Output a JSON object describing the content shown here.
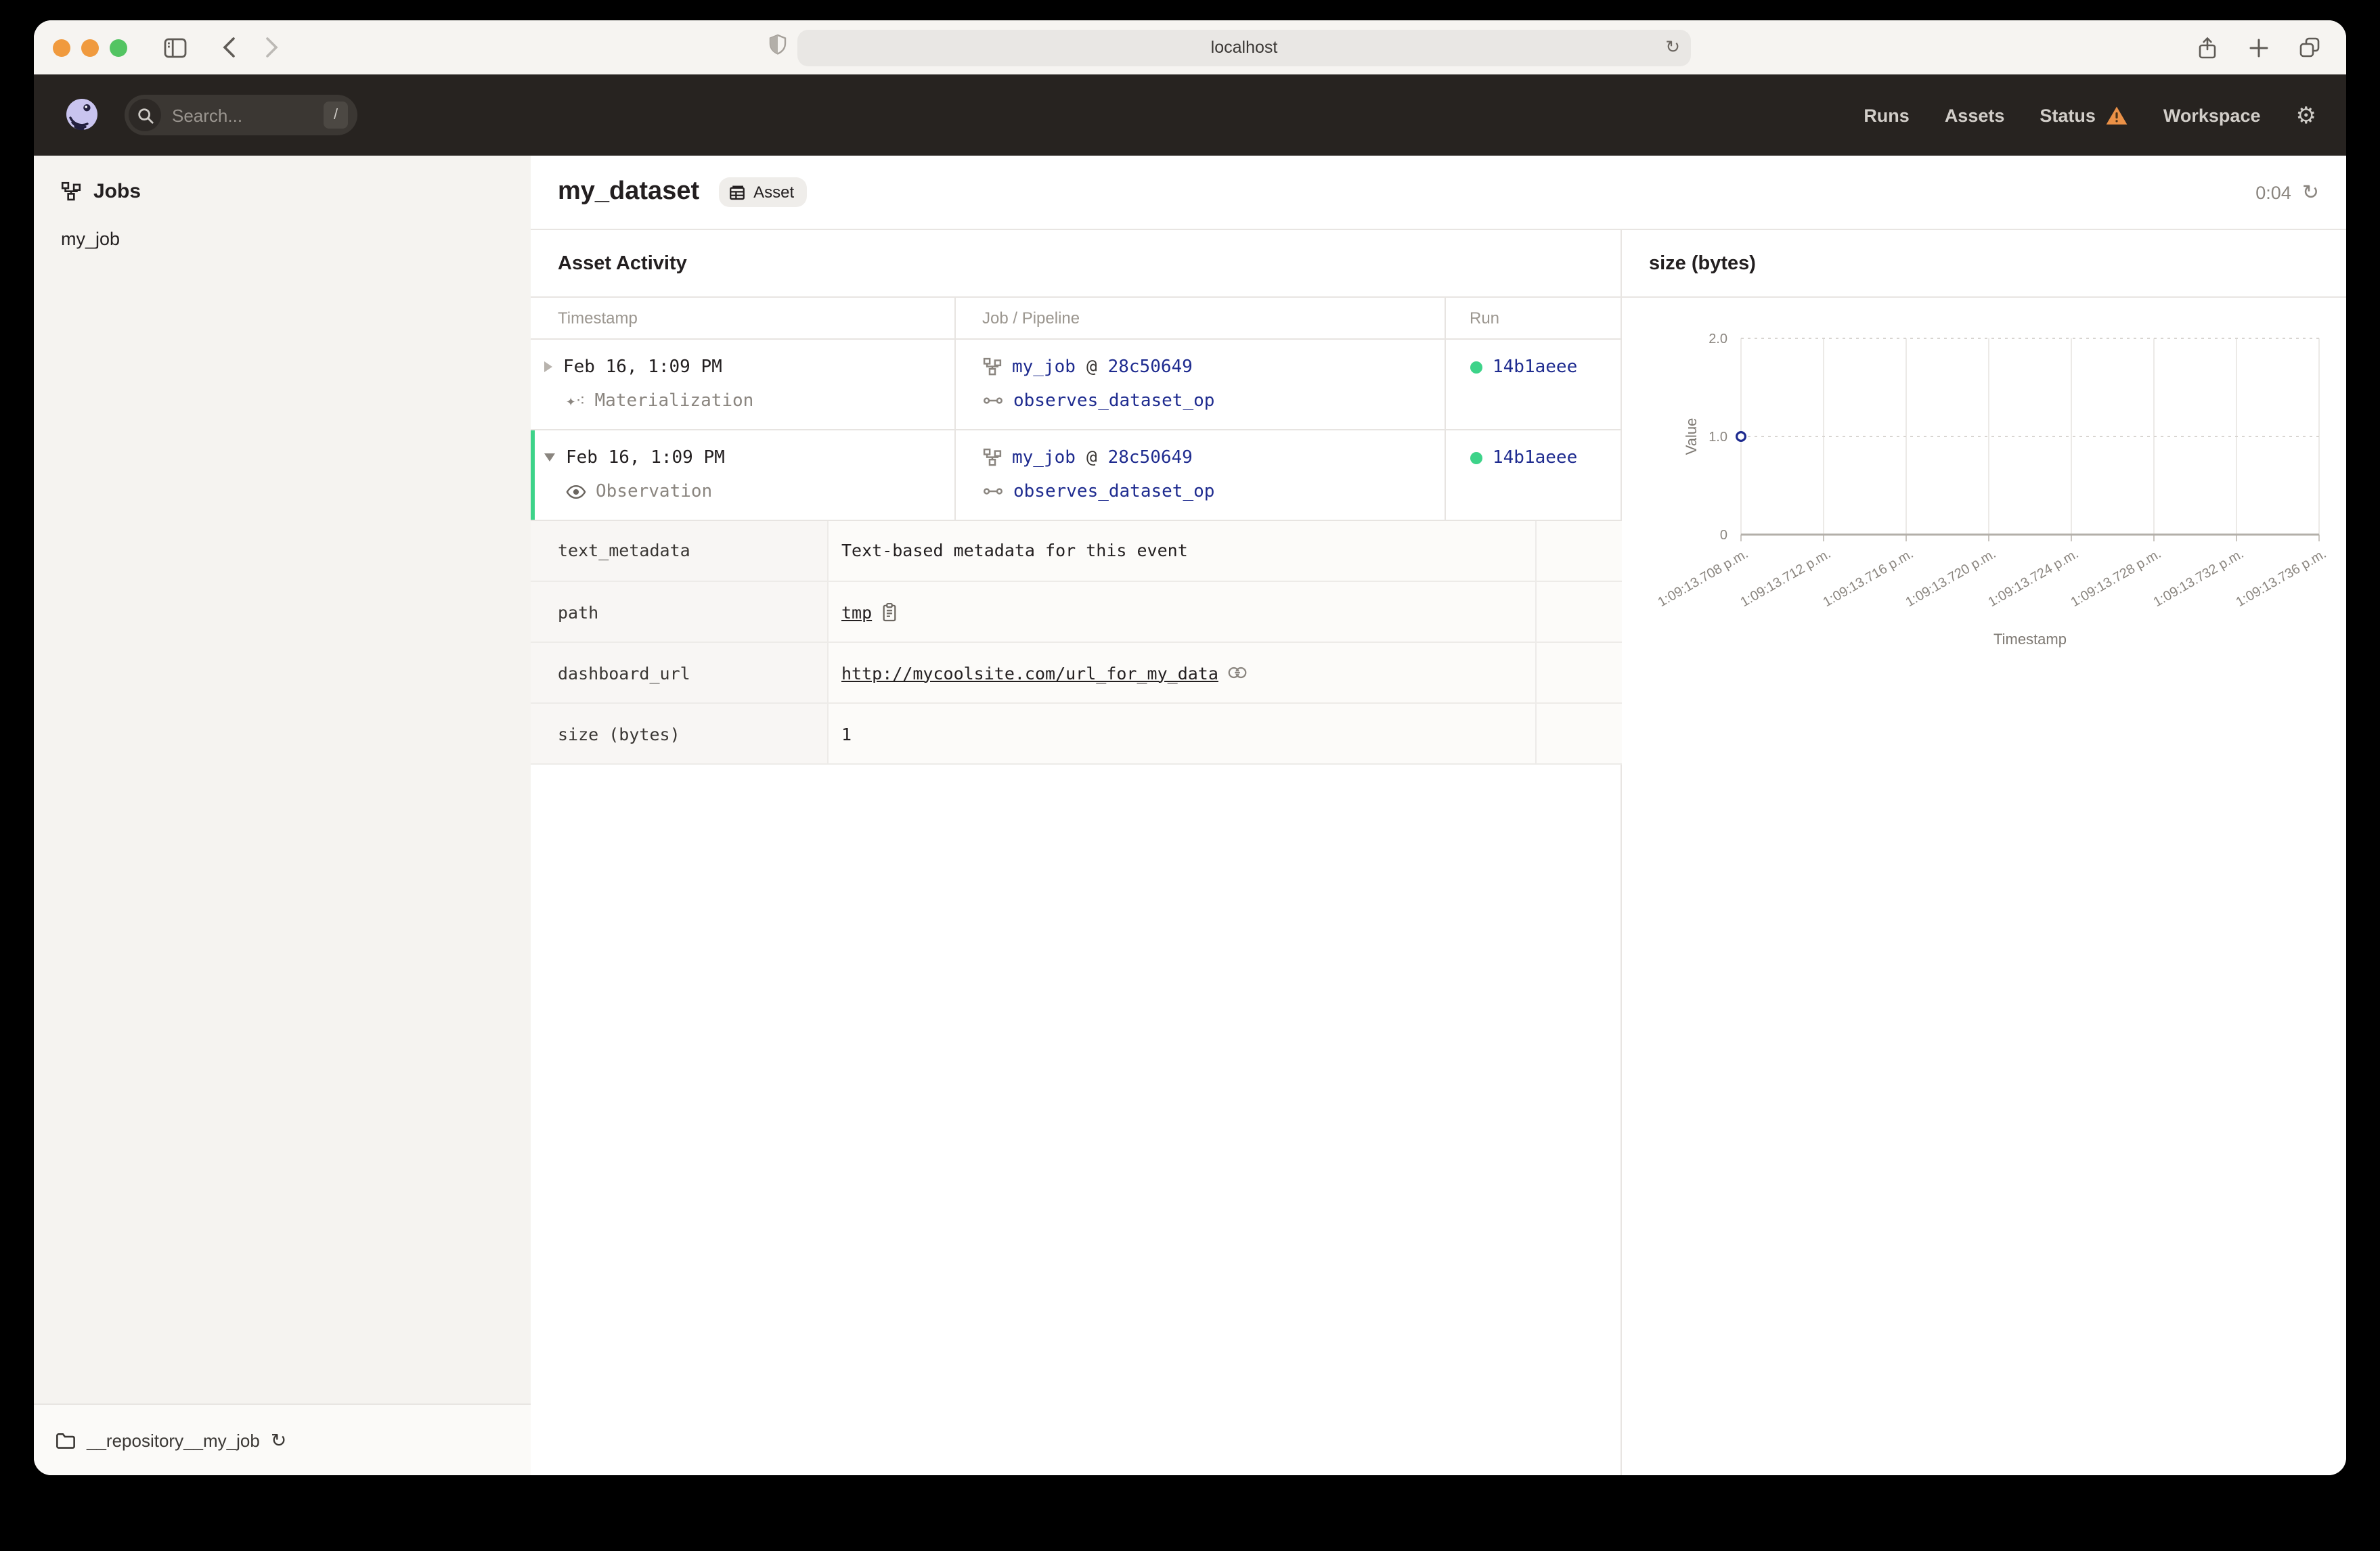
{
  "browser": {
    "url": "localhost",
    "traffic_colors": [
      "#f09a3e",
      "#f09a3e",
      "#53c462"
    ]
  },
  "navbar": {
    "search_placeholder": "Search...",
    "search_shortcut": "/",
    "items": [
      {
        "label": "Runs"
      },
      {
        "label": "Assets"
      },
      {
        "label": "Status",
        "warning": true
      },
      {
        "label": "Workspace"
      }
    ]
  },
  "sidebar": {
    "section_title": "Jobs",
    "jobs": [
      {
        "label": "my_job"
      }
    ],
    "repository": "__repository__my_job"
  },
  "header": {
    "title": "my_dataset",
    "badge": "Asset",
    "timer": "0:04"
  },
  "activity": {
    "title": "Asset Activity",
    "columns": [
      "Timestamp",
      "Job / Pipeline",
      "Run"
    ],
    "rows": [
      {
        "timestamp": "Feb 16, 1:09 PM",
        "event_type": "Materialization",
        "job": "my_job",
        "at": "@",
        "run_tag": "28c50649",
        "op": "observes_dataset_op",
        "run_id": "14b1aeee",
        "expanded": false
      },
      {
        "timestamp": "Feb 16, 1:09 PM",
        "event_type": "Observation",
        "job": "my_job",
        "at": "@",
        "run_tag": "28c50649",
        "op": "observes_dataset_op",
        "run_id": "14b1aeee",
        "expanded": true
      }
    ],
    "metadata": [
      {
        "key": "text_metadata",
        "value": "Text-based metadata for this event",
        "type": "text"
      },
      {
        "key": "path",
        "value": "tmp",
        "type": "copy"
      },
      {
        "key": "dashboard_url",
        "value": "http://mycoolsite.com/url_for_my_data",
        "type": "link"
      },
      {
        "key": "size (bytes)",
        "value": "1",
        "type": "text"
      }
    ]
  },
  "chart_data": {
    "type": "scatter",
    "title": "size (bytes)",
    "xlabel": "Timestamp",
    "ylabel": "Value",
    "x_ticks": [
      "1:09:13.708 p.m.",
      "1:09:13.712 p.m.",
      "1:09:13.716 p.m.",
      "1:09:13.720 p.m.",
      "1:09:13.724 p.m.",
      "1:09:13.728 p.m.",
      "1:09:13.732 p.m.",
      "1:09:13.736 p.m."
    ],
    "y_ticks": [
      0,
      1.0,
      2.0
    ],
    "ylim": [
      0,
      2.0
    ],
    "grid": true,
    "points": [
      {
        "x": "1:09:13.708 p.m.",
        "y": 1
      }
    ]
  },
  "colors": {
    "accent_green": "#3dd389",
    "link_navy": "#1e2b8f",
    "warning_orange": "#eb9147",
    "navbar_bg": "#272320"
  }
}
